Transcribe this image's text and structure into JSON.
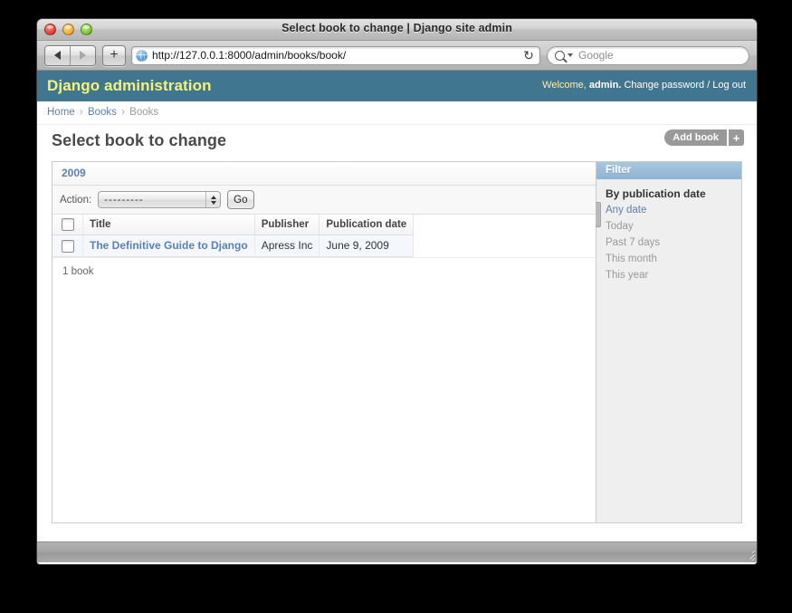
{
  "window": {
    "title": "Select book to change | Django site admin",
    "controls": [
      "close",
      "minimize",
      "zoom"
    ]
  },
  "browser": {
    "back_label": "◀",
    "forward_label": "▶",
    "new_tab_label": "+",
    "url": "http://127.0.0.1:8000/admin/books/book/",
    "reload_label": "↻",
    "search_placeholder": "Google",
    "search_value": "Google"
  },
  "header": {
    "brand": "Django administration",
    "welcome_prefix": "Welcome,",
    "username": "admin.",
    "change_password": "Change password",
    "separator": "/",
    "logout": "Log out"
  },
  "breadcrumb": {
    "items": [
      "Home",
      "Books",
      "Books"
    ],
    "separator": "›"
  },
  "content": {
    "page_title": "Select book to change",
    "add_label": "Add book",
    "add_plus": "+"
  },
  "changelist": {
    "group_header": "2009",
    "action_label": "Action:",
    "action_selected": "---------",
    "go_label": "Go",
    "columns": [
      "",
      "Title",
      "Publisher",
      "Publication date"
    ],
    "rows": [
      {
        "title": "The Definitive Guide to Django",
        "publisher": "Apress Inc",
        "publication_date": "June 9, 2009"
      }
    ],
    "paginator": "1 book"
  },
  "filter": {
    "heading": "Filter",
    "group_title": "By publication date",
    "options": [
      "Any date",
      "Today",
      "Past 7 days",
      "This month",
      "This year"
    ],
    "selected": "Any date"
  },
  "colors": {
    "django_header": "#417690",
    "brand_yellow": "#f4f379",
    "link_blue": "#5b80b2",
    "filter_bar": "#8fb4d4",
    "row_highlight": "#f4f8fd"
  }
}
